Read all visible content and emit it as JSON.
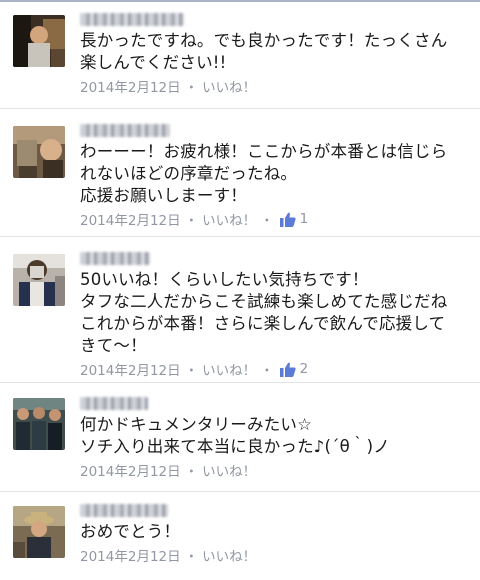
{
  "comments": [
    {
      "lines": [
        "長かったですね。でも良かったです！たっくさん",
        "楽しんでください!!"
      ],
      "date": "2014年2月12日",
      "like_label": "いいね！",
      "like_count": ""
    },
    {
      "lines": [
        "わーーー！お疲れ様！ここからが本番とは信じら",
        "れないほどの序章だったね。",
        "応援お願いしまーす！"
      ],
      "date": "2014年2月12日",
      "like_label": "いいね！",
      "like_count": "1"
    },
    {
      "lines": [
        "50いいね！くらいしたい気持ちです！",
        "タフな二人だからこそ試練も楽しめてた感じだね",
        "これからが本番！さらに楽しんで飲んで応援して",
        "きて〜！"
      ],
      "date": "2014年2月12日",
      "like_label": "いいね！",
      "like_count": "2"
    },
    {
      "lines": [
        "何かドキュメンタリーみたい☆",
        "ソチ入り出来て本当に良かった♪(´θ｀)ノ"
      ],
      "date": "2014年2月12日",
      "like_label": "いいね！",
      "like_count": ""
    },
    {
      "lines": [
        "おめでとう！"
      ],
      "date": "2014年2月12日",
      "like_label": "いいね！",
      "like_count": ""
    }
  ],
  "separator": "・",
  "icons": {
    "like_count_icon": "thumbs-up-icon"
  },
  "colors": {
    "meta_text": "#9197a3",
    "like_icon": "#5b7bd5",
    "divider": "#e3e4e8"
  }
}
